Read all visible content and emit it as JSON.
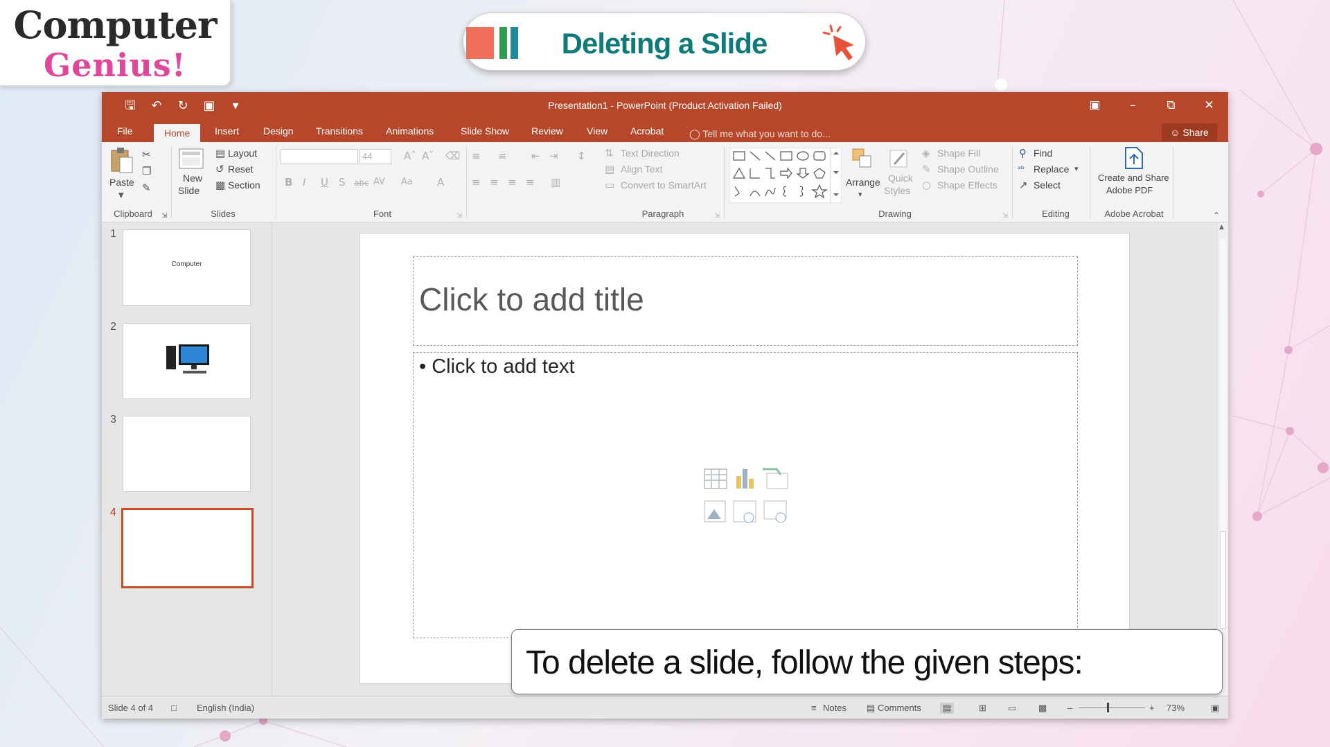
{
  "branding": {
    "logo_line1": "Computer",
    "logo_line2": "Genius!",
    "lesson_title": "Deleting a Slide"
  },
  "colors": {
    "ribbon_red": "#b7472a",
    "title_teal": "#0f7a78",
    "logo_pink": "#e0479b",
    "selection_border": "#d24726"
  },
  "window": {
    "title": "Presentation1 - PowerPoint (Product Activation Failed)"
  },
  "tabs": [
    "File",
    "Home",
    "Insert",
    "Design",
    "Transitions",
    "Animations",
    "Slide Show",
    "Review",
    "View",
    "Acrobat"
  ],
  "active_tab": "Home",
  "tell_me": "Tell me what you want to do...",
  "share": "Share",
  "ribbon": {
    "clipboard": {
      "paste": "Paste",
      "label": "Clipboard"
    },
    "slides": {
      "new_slide_1": "New",
      "new_slide_2": "Slide",
      "layout": "Layout",
      "reset": "Reset",
      "section": "Section",
      "label": "Slides"
    },
    "font": {
      "font_size": "44",
      "bold": "B",
      "italic": "I",
      "underline": "U",
      "shadow": "S",
      "strike": "abc",
      "spacing": "AV",
      "case": "Aa",
      "color": "A",
      "label": "Font"
    },
    "paragraph": {
      "text_direction": "Text Direction",
      "align_text": "Align Text",
      "convert": "Convert to SmartArt",
      "label": "Paragraph"
    },
    "drawing": {
      "arrange": "Arrange",
      "quick_styles_1": "Quick",
      "quick_styles_2": "Styles",
      "shape_fill": "Shape Fill",
      "shape_outline": "Shape Outline",
      "shape_effects": "Shape Effects",
      "label": "Drawing"
    },
    "editing": {
      "find": "Find",
      "replace": "Replace",
      "select": "Select",
      "label": "Editing"
    },
    "acrobat": {
      "create_1": "Create and Share",
      "create_2": "Adobe PDF",
      "label": "Adobe Acrobat"
    }
  },
  "thumbnails": [
    {
      "number": "1",
      "text": "Computer"
    },
    {
      "number": "2",
      "text": ""
    },
    {
      "number": "3",
      "text": ""
    },
    {
      "number": "4",
      "text": ""
    }
  ],
  "selected_slide": 4,
  "slide": {
    "title_placeholder": "Click to add title",
    "body_placeholder": "• Click to add text"
  },
  "status": {
    "slide_count": "Slide 4 of 4",
    "language": "English (India)",
    "notes": "Notes",
    "comments": "Comments",
    "zoom": "73%"
  },
  "caption": "To delete a slide, follow the given steps:"
}
